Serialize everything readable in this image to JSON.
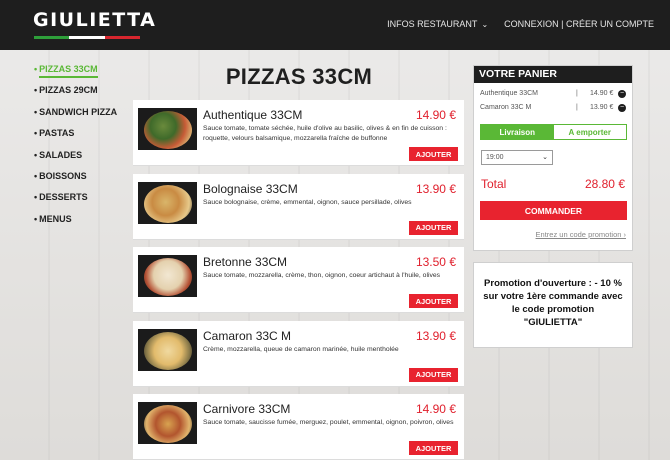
{
  "header": {
    "logo": "GIULIETTA",
    "flag_colors": [
      "#2e9f3a",
      "#ffffff",
      "#d7262e"
    ],
    "nav": [
      {
        "label": "INFOS RESTAURANT",
        "icon": "chevron-down-icon"
      },
      {
        "label": "CONNEXION | CRÉER UN COMPTE"
      }
    ]
  },
  "sidebar": {
    "items": [
      {
        "label": "PIZZAS 33CM",
        "active": true
      },
      {
        "label": "PIZZAS 29CM"
      },
      {
        "label": "SANDWICH PIZZA"
      },
      {
        "label": "PASTAS"
      },
      {
        "label": "SALADES"
      },
      {
        "label": "BOISSONS"
      },
      {
        "label": "DESSERTS"
      },
      {
        "label": "MENUS"
      }
    ]
  },
  "main": {
    "title": "PIZZAS 33CM",
    "add_label": "AJOUTER",
    "products": [
      {
        "name": "Authentique 33CM",
        "price": "14.90 €",
        "desc": "Sauce tomate, tomate séchée, huile d'olive au basilic, olives & en fin de cuisson : roquette, velours balsamique, mozzarella fraîche de buffonne"
      },
      {
        "name": "Bolognaise 33CM",
        "price": "13.90 €",
        "desc": "Sauce bolognaise, crème, emmental, oignon, sauce persillade, olives"
      },
      {
        "name": "Bretonne 33CM",
        "price": "13.50 €",
        "desc": "Sauce tomate, mozzarella, crème, thon, oignon, coeur artichaut à l'huile, olives"
      },
      {
        "name": "Camaron 33C M",
        "price": "13.90 €",
        "desc": "Crème, mozzarella, queue de camaron marinée, huile mentholée"
      },
      {
        "name": "Carnivore 33CM",
        "price": "14.90 €",
        "desc": "Sauce tomate, saucisse fumée, merguez, poulet, emmental, oignon, poivron, olives"
      }
    ]
  },
  "cart": {
    "title": "VOTRE PANIER",
    "lines": [
      {
        "name": "Authentique 33CM",
        "sep": "|",
        "price": "14.90 €"
      },
      {
        "name": "Camaron 33C M",
        "sep": "|",
        "price": "13.90 €"
      }
    ],
    "delivery_label": "Livraison",
    "takeaway_label": "A emporter",
    "time_value": "19:00",
    "total_label": "Total",
    "total_value": "28.80 €",
    "order_label": "COMMANDER",
    "promo_link": "Entrez un code promotion ›"
  },
  "promo": {
    "text": "Promotion d'ouverture : - 10 % sur votre 1ère commande avec le code promotion \"GIULIETTA\""
  },
  "colors": {
    "accent_red": "#e8232f",
    "accent_green": "#5ab836",
    "header_bg": "#1e1e1e"
  }
}
